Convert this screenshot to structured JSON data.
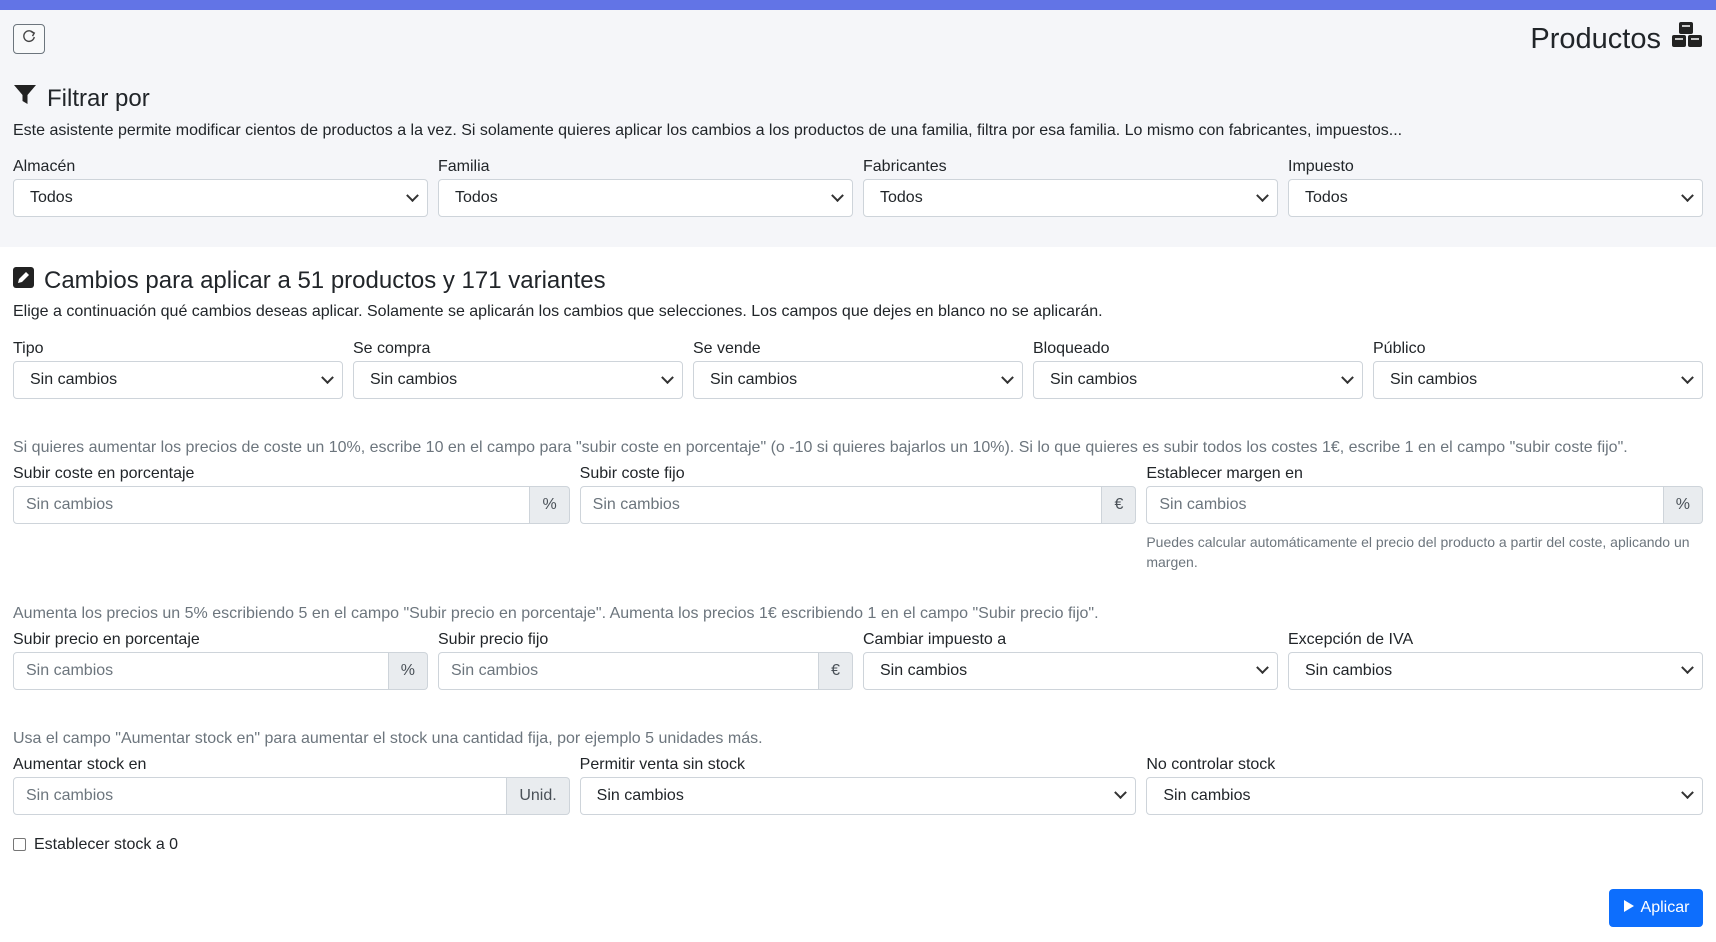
{
  "header": {
    "title": "Productos",
    "icon": "cubes-icon"
  },
  "filter": {
    "title": "Filtrar por",
    "description": "Este asistente permite modificar cientos de productos a la vez. Si solamente quieres aplicar los cambios a los productos de una familia, filtra por esa familia. Lo mismo con fabricantes, impuestos...",
    "fields": [
      {
        "label": "Almacén",
        "value": "Todos"
      },
      {
        "label": "Familia",
        "value": "Todos"
      },
      {
        "label": "Fabricantes",
        "value": "Todos"
      },
      {
        "label": "Impuesto",
        "value": "Todos"
      }
    ]
  },
  "changes": {
    "title": "Cambios para aplicar a 51 productos y 171 variantes",
    "description": "Elige a continuación qué cambios deseas aplicar. Solamente se aplicarán los cambios que selecciones. Los campos que dejes en blanco no se aplicarán.",
    "row1": [
      {
        "label": "Tipo",
        "value": "Sin cambios"
      },
      {
        "label": "Se compra",
        "value": "Sin cambios"
      },
      {
        "label": "Se vende",
        "value": "Sin cambios"
      },
      {
        "label": "Bloqueado",
        "value": "Sin cambios"
      },
      {
        "label": "Público",
        "value": "Sin cambios"
      }
    ],
    "cost_hint": "Si quieres aumentar los precios de coste un 10%, escribe 10 en el campo para \"subir coste en porcentaje\" (o -10 si quieres bajarlos un 10%). Si lo que quieres es subir todos los costes 1€, escribe 1 en el campo \"subir coste fijo\".",
    "cost_pct": {
      "label": "Subir coste en porcentaje",
      "placeholder": "Sin cambios",
      "addon": "%"
    },
    "cost_fixed": {
      "label": "Subir coste fijo",
      "placeholder": "Sin cambios",
      "addon": "€"
    },
    "margin": {
      "label": "Establecer margen en",
      "placeholder": "Sin cambios",
      "addon": "%",
      "help": "Puedes calcular automáticamente el precio del producto a partir del coste, aplicando un margen."
    },
    "price_hint": "Aumenta los precios un 5% escribiendo 5 en el campo \"Subir precio en porcentaje\". Aumenta los precios 1€ escribiendo 1 en el campo \"Subir precio fijo\".",
    "price_pct": {
      "label": "Subir precio en porcentaje",
      "placeholder": "Sin cambios",
      "addon": "%"
    },
    "price_fixed": {
      "label": "Subir precio fijo",
      "placeholder": "Sin cambios",
      "addon": "€"
    },
    "tax": {
      "label": "Cambiar impuesto a",
      "value": "Sin cambios"
    },
    "vat_exc": {
      "label": "Excepción de IVA",
      "value": "Sin cambios"
    },
    "stock_hint": "Usa el campo \"Aumentar stock en\" para aumentar el stock una cantidad fija, por ejemplo 5 unidades más.",
    "stock_add": {
      "label": "Aumentar stock en",
      "placeholder": "Sin cambios",
      "addon": "Unid."
    },
    "allow_nostock": {
      "label": "Permitir venta sin stock",
      "value": "Sin cambios"
    },
    "no_control": {
      "label": "No controlar stock",
      "value": "Sin cambios"
    },
    "stock_zero": "Establecer stock a 0",
    "apply": "Aplicar"
  }
}
